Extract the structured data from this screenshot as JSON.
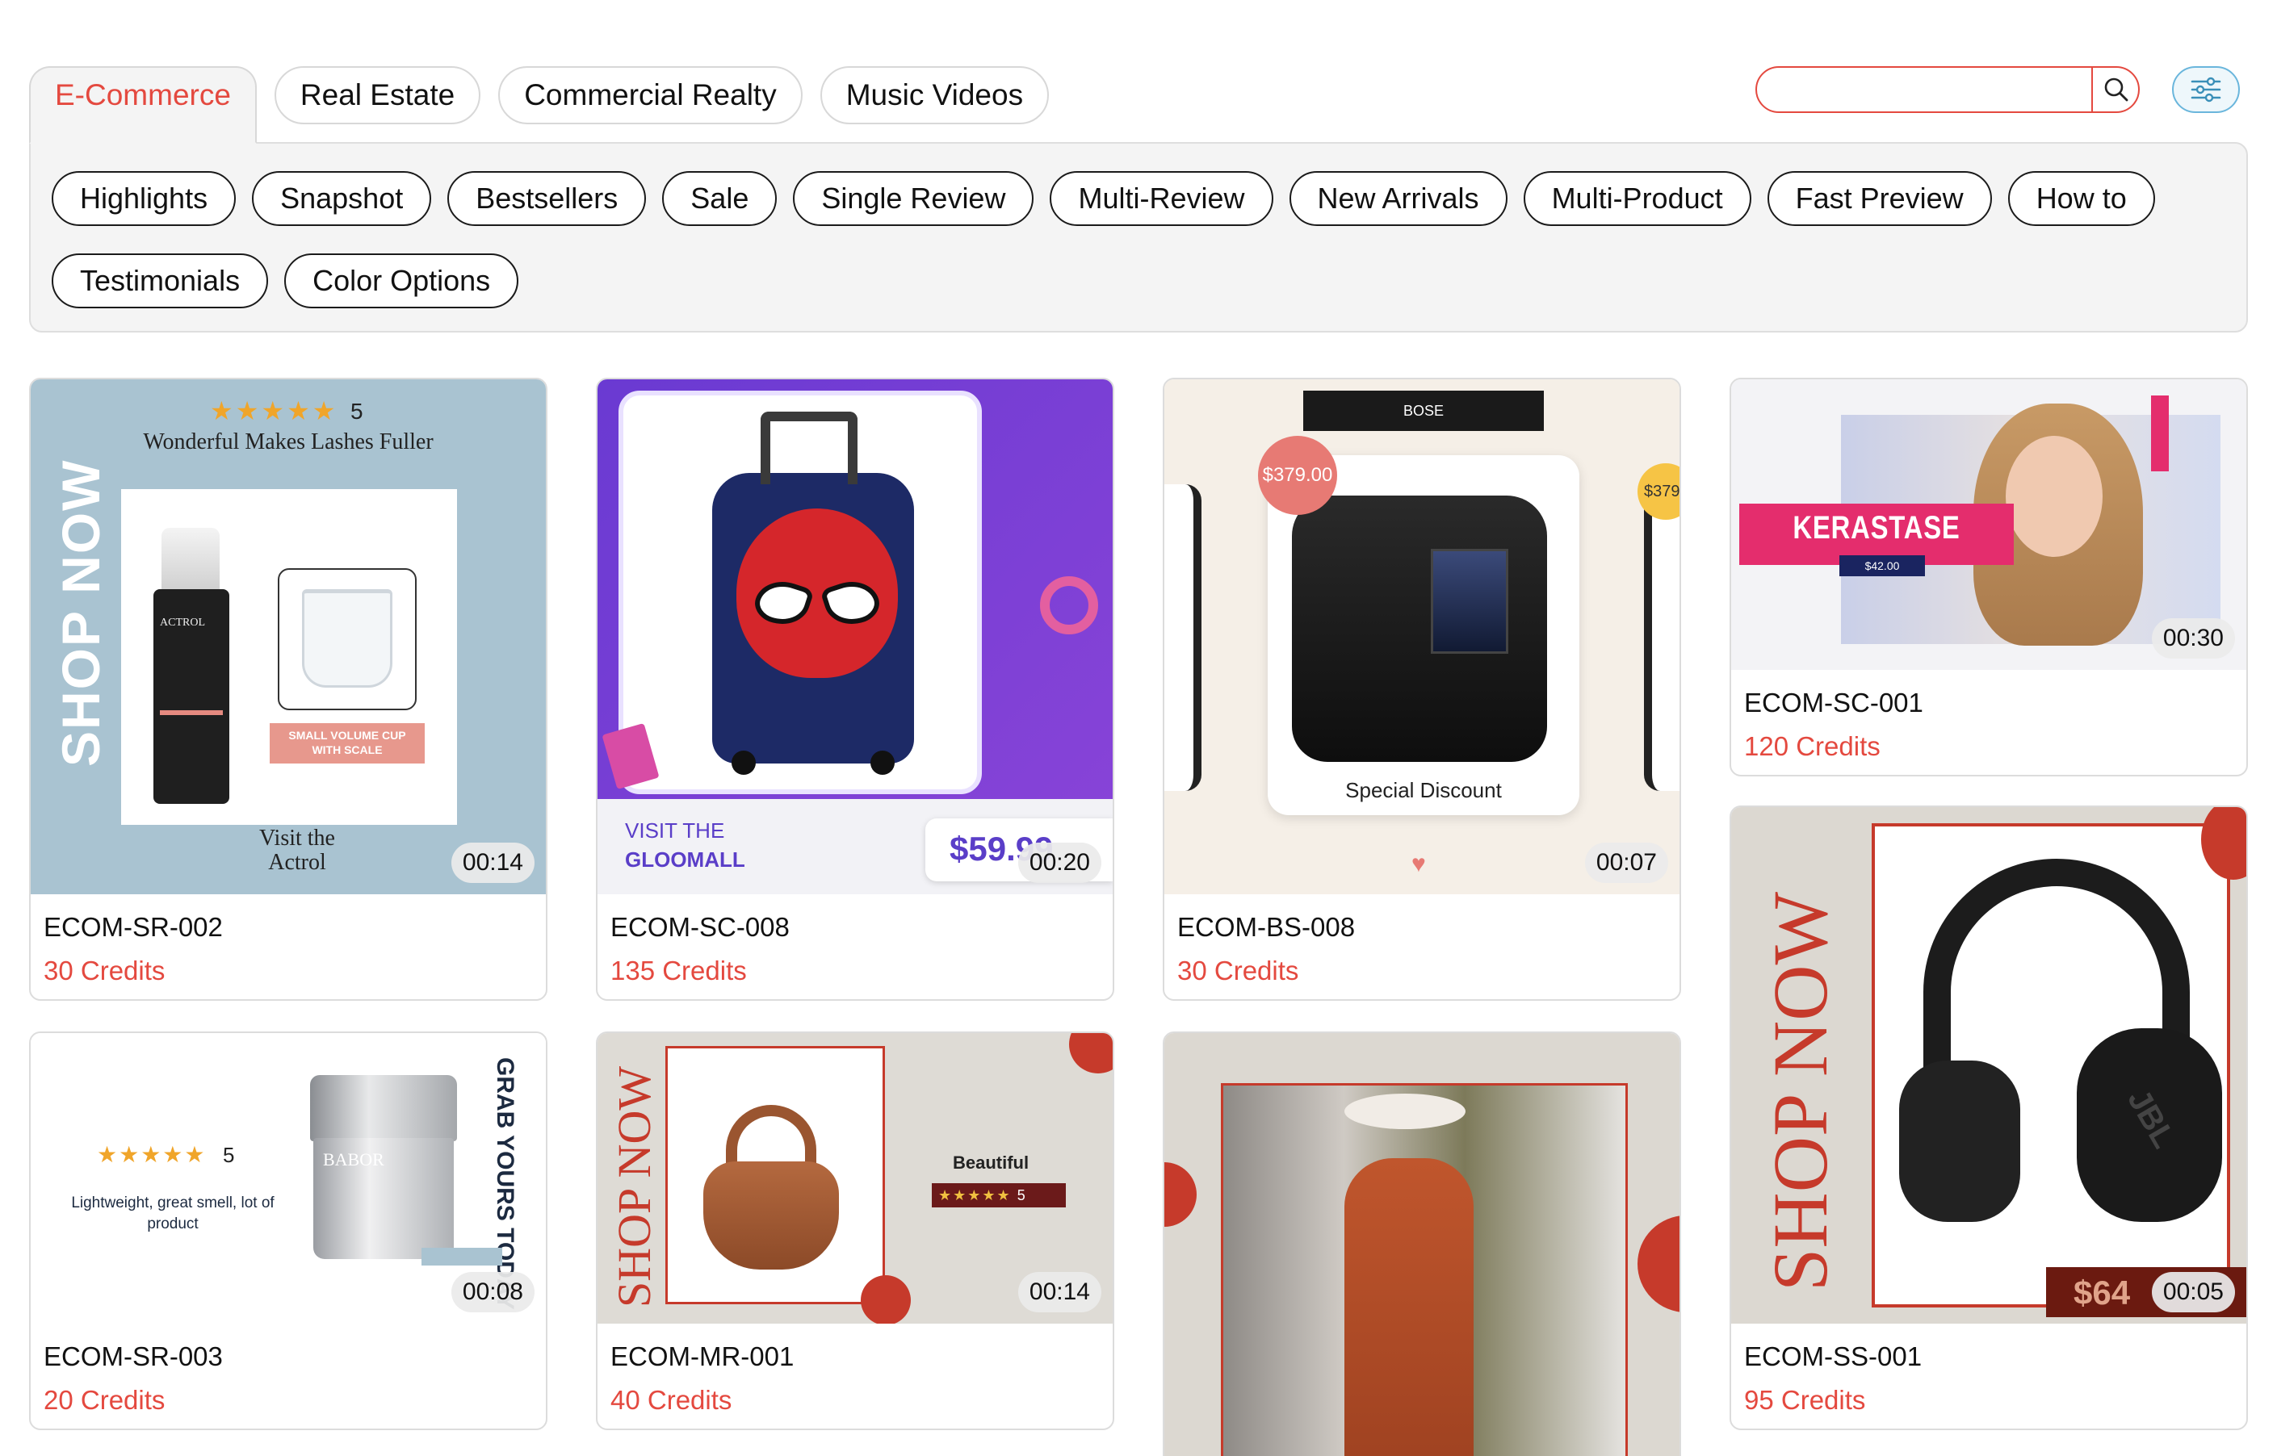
{
  "tabs": [
    {
      "label": "E-Commerce",
      "active": true
    },
    {
      "label": "Real Estate",
      "active": false
    },
    {
      "label": "Commercial Realty",
      "active": false
    },
    {
      "label": "Music Videos",
      "active": false
    }
  ],
  "search": {
    "placeholder": "",
    "value": "",
    "icon": "search-icon"
  },
  "filter": {
    "icon": "sliders-icon"
  },
  "subcategories": [
    "Highlights",
    "Snapshot",
    "Bestsellers",
    "Sale",
    "Single Review",
    "Multi-Review",
    "New Arrivals",
    "Multi-Product",
    "Fast Preview",
    "How to",
    "Testimonials",
    "Color Options"
  ],
  "colors": {
    "accent": "#e4493f",
    "panel": "#f4f4f4",
    "filter": "#6ab6dc"
  },
  "cards": {
    "c1": {
      "code": "ECOM-SR-002",
      "credits": "30 Credits",
      "duration": "00:14",
      "rating": "5",
      "headline": "Wonderful Makes Lashes Fuller",
      "side_text": "SHOP NOW",
      "brand": "ACTROL",
      "badge": "SMALL VOLUME CUP WITH SCALE",
      "footer": "Visit the Actrol"
    },
    "c2": {
      "code": "ECOM-SC-008",
      "credits": "135 Credits",
      "duration": "00:20",
      "visit": "VISIT THE",
      "store": "GLOOMALL",
      "price": "$59.99"
    },
    "c3": {
      "code": "ECOM-BS-008",
      "credits": "30 Credits",
      "duration": "00:07",
      "brand": "BOSE",
      "price": "$379.00",
      "price_peek": "$379.",
      "caption": "Special Discount"
    },
    "c4": {
      "code": "ECOM-SC-001",
      "credits": "120 Credits",
      "duration": "00:30",
      "brand": "KERASTASE",
      "price": "$42.00"
    },
    "c5": {
      "code": "ECOM-SR-003",
      "credits": "20 Credits",
      "duration": "00:08",
      "rating": "5",
      "review": "Lightweight, great smell, lot of product",
      "side_text": "GRAB YOURS TODAY",
      "brand": "BABOR"
    },
    "c6": {
      "code": "ECOM-MR-001",
      "credits": "40 Credits",
      "duration": "00:14",
      "side_text": "SHOP NOW",
      "label": "Beautiful",
      "rating": "5"
    },
    "c7": {},
    "c8": {
      "code": "ECOM-SS-001",
      "credits": "95 Credits",
      "duration": "00:05",
      "side_text": "SHOP NOW",
      "price": "$64",
      "brand": "JBL"
    }
  }
}
